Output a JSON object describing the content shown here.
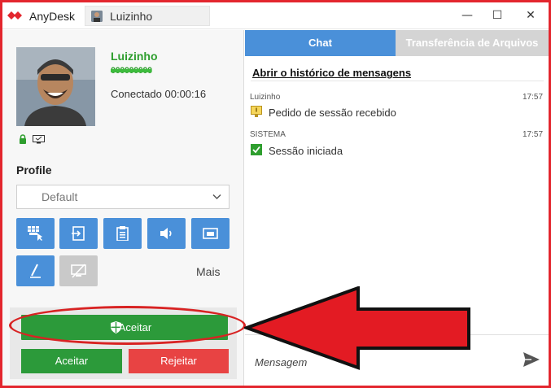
{
  "colors": {
    "brand": "#e3262e",
    "accent": "#4a90d9",
    "online": "#2e9e2e",
    "accept": "#2c9a3a",
    "reject": "#e84343",
    "annotation": "#e31b23"
  },
  "titlebar": {
    "app_name": "AnyDesk",
    "logo_icon": "anydesk-logo-icon",
    "tab_label": "Luizinho",
    "minimize": "—",
    "maximize": "☐",
    "close": "✕"
  },
  "client": {
    "name": "Luizinho",
    "id_redacted": "000000000",
    "status": "Conectado 00:00:16",
    "icons": [
      "lock-icon",
      "monitor-icon"
    ]
  },
  "profile": {
    "heading": "Profile",
    "selected": "Default"
  },
  "tools": [
    {
      "name": "keyboard-icon"
    },
    {
      "name": "switch-side-icon"
    },
    {
      "name": "clipboard-icon"
    },
    {
      "name": "audio-icon"
    },
    {
      "name": "screen-icon"
    },
    {
      "name": "draw-icon"
    },
    {
      "name": "block-input-icon",
      "disabled": true
    }
  ],
  "more_label": "Mais",
  "actions": {
    "accept_main": "Aceitar",
    "accept": "Aceitar",
    "reject": "Rejeitar"
  },
  "tabs": {
    "chat": "Chat",
    "files": "Transferência de Arquivos"
  },
  "chat": {
    "history_link": "Abrir o histórico de mensagens",
    "messages": [
      {
        "sender": "Luizinho",
        "time": "17:57",
        "text": "Pedido de sessão recebido",
        "icon": "session-request-icon"
      },
      {
        "sender": "SISTEMA",
        "time": "17:57",
        "text": "Sessão iniciada",
        "icon": "check-icon"
      }
    ],
    "placeholder": "Mensagem"
  }
}
